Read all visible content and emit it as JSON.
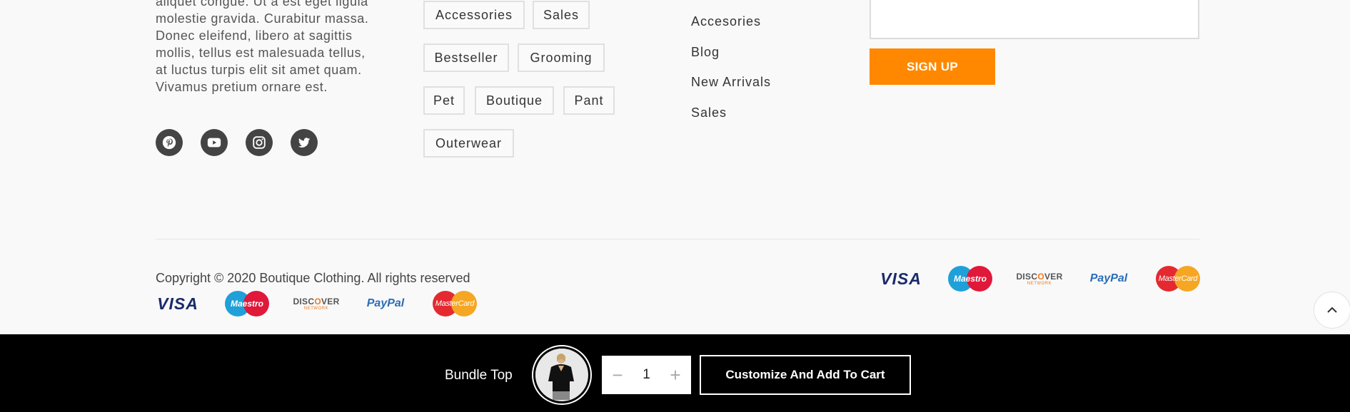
{
  "about": {
    "lines": [
      "aliquet congue. Ut a est eget ligula",
      "molestie gravida. Curabitur massa.",
      "Donec eleifend, libero at sagittis",
      "mollis, tellus est malesuada tellus,",
      "at luctus turpis elit sit amet quam.",
      "Vivamus pretium ornare est."
    ]
  },
  "social": {
    "icons": [
      "pinterest-icon",
      "youtube-icon",
      "instagram-icon",
      "twitter-icon"
    ]
  },
  "tags": [
    "Accessories",
    "Sales",
    "Bestseller",
    "Grooming",
    "Pet",
    "Boutique",
    "Pant",
    "Outerwear"
  ],
  "links": [
    "Accesories",
    "Blog",
    "New Arrivals",
    "Sales"
  ],
  "newsletter": {
    "email_placeholder": "",
    "signup_label": "SIGN UP"
  },
  "footer": {
    "copyright": "Copyright © 2020 Boutique Clothing. All rights reserved",
    "payments": {
      "visa": "VISA",
      "maestro": "Maestro",
      "discover_main": "DISC",
      "discover_o": "O",
      "discover_end": "VER",
      "discover_sub": "NETWORK",
      "paypal": "PayPal",
      "mastercard": "MasterCard"
    }
  },
  "sticky_bar": {
    "product_title": "Bundle Top",
    "quantity": "1",
    "minus": "−",
    "plus": "+",
    "cta_label": "Customize And Add To Cart"
  },
  "colors": {
    "accent": "#ff8800",
    "icon_bg": "#444444",
    "sticky_bg": "#000000"
  }
}
